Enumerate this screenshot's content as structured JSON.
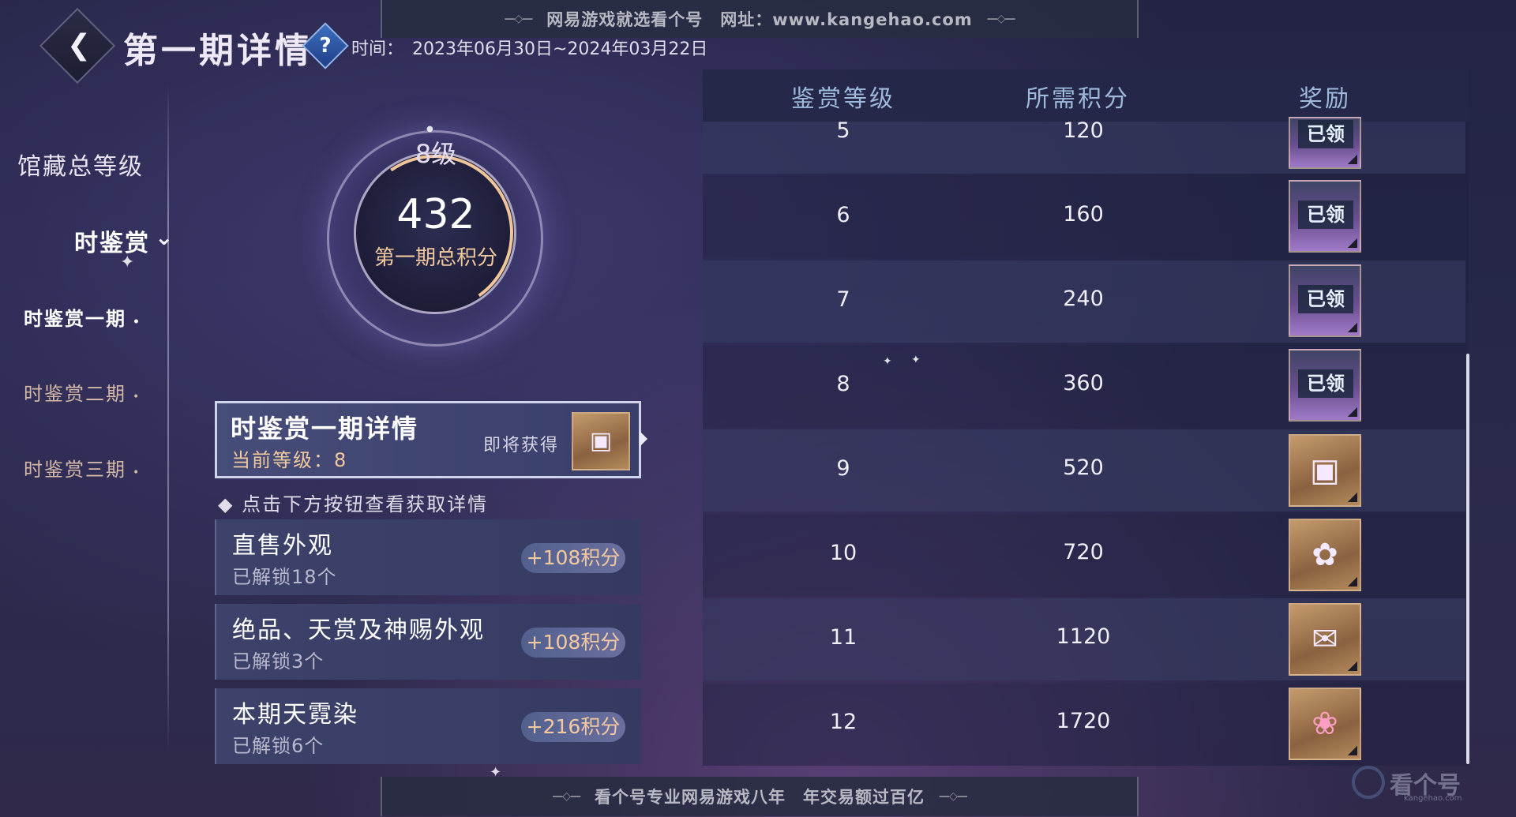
{
  "watermark": {
    "top_text": "网易游戏就选看个号　网址：www.kangehao.com",
    "bottom_text": "看个号专业网易游戏八年　年交易额过百亿",
    "corner_logo": "看个号",
    "corner_logo_sub": "kangehao.com"
  },
  "header": {
    "title": "第一期详情",
    "help_icon": "question-icon",
    "date_label": "时间：",
    "date_value": "2023年06月30日~2024年03月22日"
  },
  "nav": {
    "main_label": "馆藏总等级",
    "sub_head": "时鉴赏",
    "items": [
      {
        "label": "时鉴赏一期",
        "active": true
      },
      {
        "label": "时鉴赏二期",
        "active": false
      },
      {
        "label": "时鉴赏三期",
        "active": false
      }
    ]
  },
  "ring": {
    "level": "8级",
    "score": "432",
    "label": "第一期总积分"
  },
  "detail_card": {
    "title": "时鉴赏一期详情",
    "current_level": "当前等级：8",
    "soon_label": "即将获得"
  },
  "hint": "点击下方按钮查看获取详情",
  "sources": [
    {
      "title": "直售外观",
      "sub": "已解锁18个",
      "points": "+108积分"
    },
    {
      "title": "绝品、天赏及神赐外观",
      "sub": "已解锁3个",
      "points": "+108积分"
    },
    {
      "title": "本期天霓染",
      "sub": "已解锁6个",
      "points": "+216积分"
    }
  ],
  "table": {
    "headers": [
      "鉴赏等级",
      "所需积分",
      "奖励"
    ],
    "claimed_text": "已领",
    "rows": [
      {
        "level": "5",
        "score": "120",
        "claimed": true,
        "style": "purple"
      },
      {
        "level": "6",
        "score": "160",
        "claimed": true,
        "style": "purple"
      },
      {
        "level": "7",
        "score": "240",
        "claimed": true,
        "style": "purple"
      },
      {
        "level": "8",
        "score": "360",
        "claimed": true,
        "style": "purple"
      },
      {
        "level": "9",
        "score": "520",
        "claimed": false,
        "style": "gold",
        "icon": "frame-icon"
      },
      {
        "level": "10",
        "score": "720",
        "claimed": false,
        "style": "gold",
        "icon": "flower-orb-icon"
      },
      {
        "level": "11",
        "score": "1120",
        "claimed": false,
        "style": "gold",
        "icon": "letter-icon"
      },
      {
        "level": "12",
        "score": "1720",
        "claimed": false,
        "style": "gold",
        "icon": "pink-flower-icon"
      }
    ]
  }
}
